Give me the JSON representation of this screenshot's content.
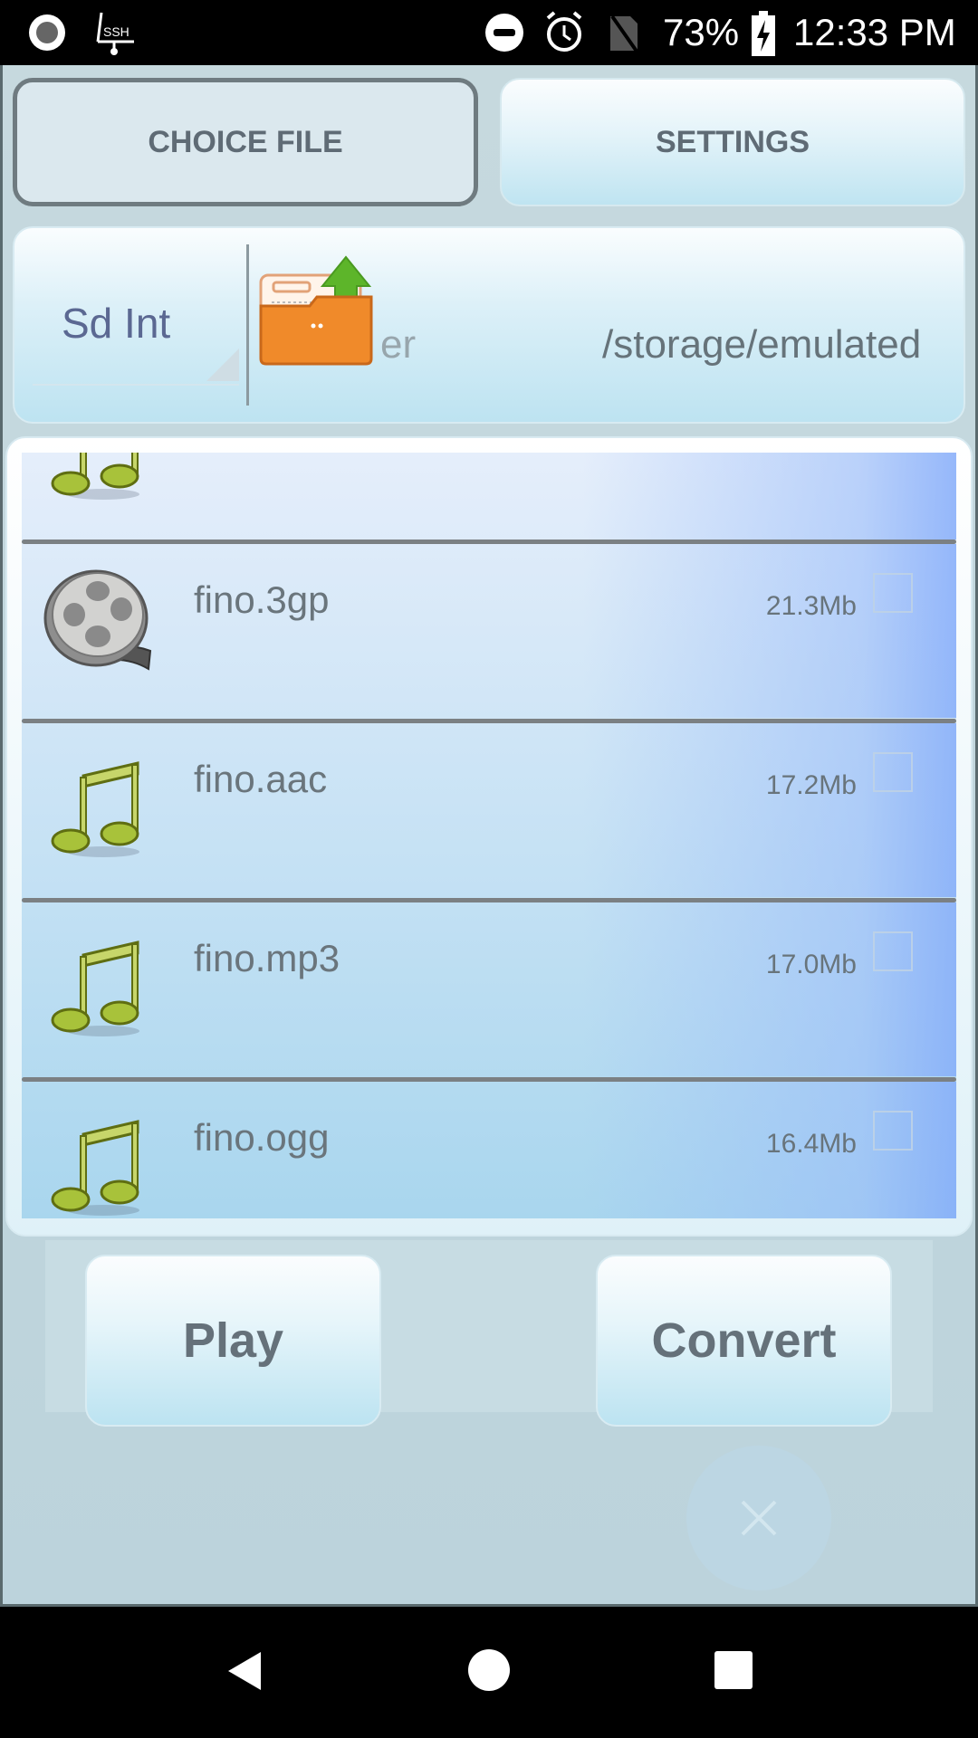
{
  "status_bar": {
    "battery": "73%",
    "time": "12:33 PM",
    "icons": [
      "record-icon",
      "ssh-icon",
      "do-not-disturb-icon",
      "alarm-icon",
      "no-sim-icon",
      "battery-charging-icon"
    ]
  },
  "toolbar": {
    "choice_file_label": "CHOICE FILE",
    "settings_label": "SETTINGS"
  },
  "path_panel": {
    "storage_selected": "Sd Int",
    "up_hidden_text": "er",
    "current_path": "/storage/emulated"
  },
  "files": [
    {
      "name": "",
      "size": "",
      "type": "audio",
      "icon": "music-note-icon"
    },
    {
      "name": "fino.3gp",
      "size": "21.3Mb",
      "type": "video",
      "icon": "film-reel-icon"
    },
    {
      "name": "fino.aac",
      "size": "17.2Mb",
      "type": "audio",
      "icon": "music-note-icon"
    },
    {
      "name": "fino.mp3",
      "size": "17.0Mb",
      "type": "audio",
      "icon": "music-note-icon"
    },
    {
      "name": "fino.ogg",
      "size": "16.4Mb",
      "type": "audio",
      "icon": "music-note-icon"
    }
  ],
  "actions": {
    "play_label": "Play",
    "convert_label": "Convert"
  },
  "colors": {
    "button_text": "#5f6b75",
    "path_text": "#66737a",
    "storage_text": "#5b6892",
    "note_green": "#a8c23a",
    "folder_orange": "#f08a2a",
    "arrow_green": "#5db52a"
  }
}
